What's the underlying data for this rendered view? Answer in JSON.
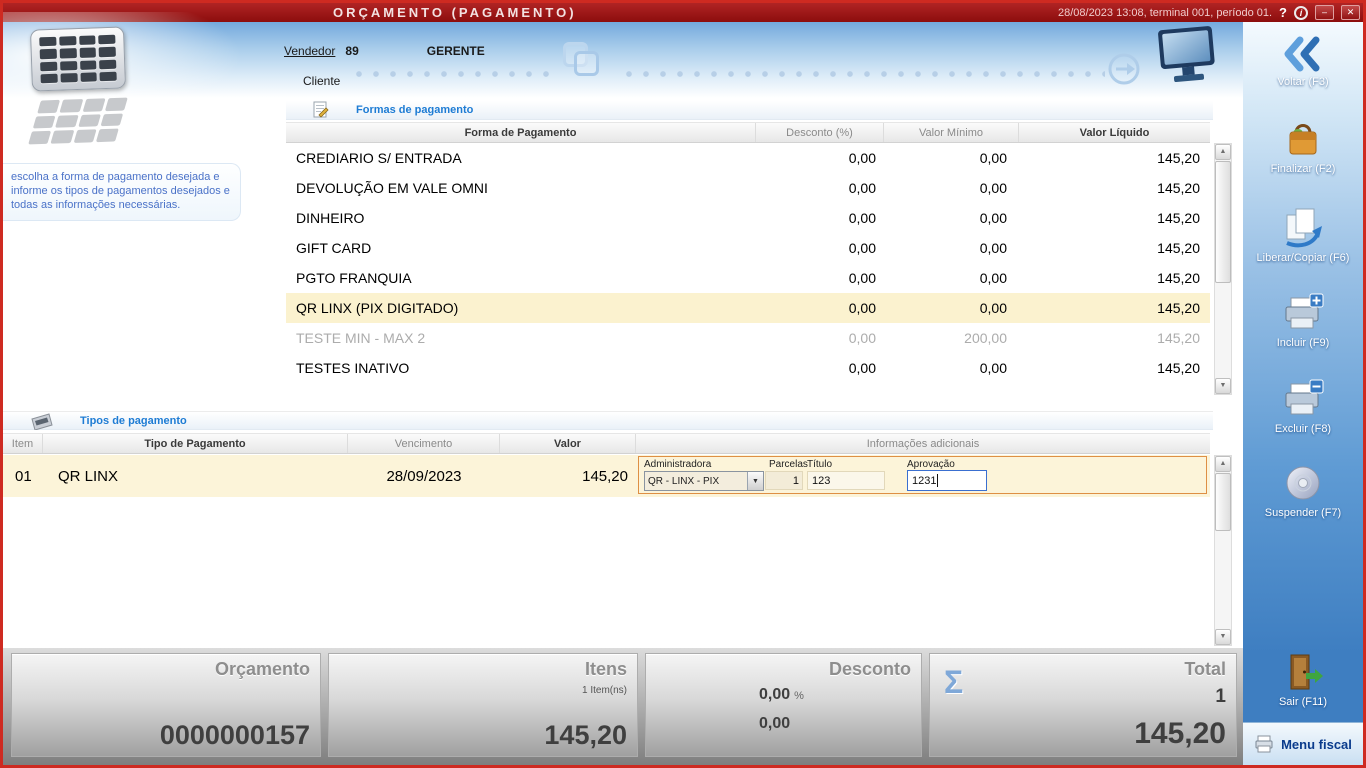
{
  "titlebar": {
    "title": "ORÇAMENTO (PAGAMENTO)",
    "status": "28/08/2023 13:08, terminal 001, período 01.",
    "help_glyph": "?",
    "info_glyph": "i",
    "minimize_glyph": "–",
    "close_glyph": "✕"
  },
  "header": {
    "vendedor_label": "Vendedor",
    "vendedor_code": "89",
    "vendedor_name": "GERENTE",
    "cliente_label": "Cliente"
  },
  "instructions": "escolha a forma de pagamento desejada e informe os tipos de pagamentos desejados e todas as informações necessárias.",
  "formas": {
    "title": "Formas de pagamento",
    "columns": {
      "forma": "Forma de Pagamento",
      "desconto": "Desconto (%)",
      "minimo": "Valor Mínimo",
      "liquido": "Valor Líquido"
    },
    "rows": [
      {
        "forma": "CREDIARIO S/ ENTRADA",
        "desconto": "0,00",
        "minimo": "0,00",
        "liquido": "145,20"
      },
      {
        "forma": "DEVOLUÇÃO EM VALE OMNI",
        "desconto": "0,00",
        "minimo": "0,00",
        "liquido": "145,20"
      },
      {
        "forma": "DINHEIRO",
        "desconto": "0,00",
        "minimo": "0,00",
        "liquido": "145,20"
      },
      {
        "forma": "GIFT CARD",
        "desconto": "0,00",
        "minimo": "0,00",
        "liquido": "145,20"
      },
      {
        "forma": "PGTO FRANQUIA",
        "desconto": "0,00",
        "minimo": "0,00",
        "liquido": "145,20"
      },
      {
        "forma": "QR LINX (PIX DIGITADO)",
        "desconto": "0,00",
        "minimo": "0,00",
        "liquido": "145,20"
      },
      {
        "forma": "TESTE MIN - MAX 2",
        "desconto": "0,00",
        "minimo": "200,00",
        "liquido": "145,20"
      },
      {
        "forma": "TESTES INATIVO",
        "desconto": "0,00",
        "minimo": "0,00",
        "liquido": "145,20"
      }
    ]
  },
  "tipos": {
    "title": "Tipos de pagamento",
    "columns": {
      "item": "Item",
      "tipo": "Tipo de Pagamento",
      "vencimento": "Vencimento",
      "valor": "Valor",
      "info": "Informações adicionais"
    },
    "row": {
      "item": "01",
      "tipo": "QR LINX",
      "vencimento": "28/09/2023",
      "valor": "145,20",
      "administradora_label": "Administradora",
      "administradora_value": "QR - LINX - PIX",
      "parcelas_label": "Parcelas",
      "parcelas_value": "1",
      "titulo_label": "Título",
      "titulo_value": "123",
      "aprovacao_label": "Aprovação",
      "aprovacao_value": "1231"
    }
  },
  "summary": {
    "orcamento_label": "Orçamento",
    "orcamento_value": "0000000157",
    "itens_label": "Itens",
    "itens_sub": "1 Item(ns)",
    "itens_value": "145,20",
    "desconto_label": "Desconto",
    "desconto_percent": "0,00",
    "percent_sign": "%",
    "desconto_value": "0,00",
    "total_label": "Total",
    "total_sigma": "Σ",
    "total_count": "1",
    "total_value": "145,20"
  },
  "actions": {
    "voltar": "Voltar (F3)",
    "finalizar": "Finalizar (F2)",
    "liberar": "Liberar/Copiar (F6)",
    "incluir": "Incluir (F9)",
    "excluir": "Excluir (F8)",
    "suspender": "Suspender (F7)",
    "sair": "Sair (F11)",
    "menu_fiscal": "Menu fiscal"
  },
  "glyphs": {
    "scroll_up": "▲",
    "scroll_down": "▼",
    "dropdown_arrow": "▼"
  }
}
